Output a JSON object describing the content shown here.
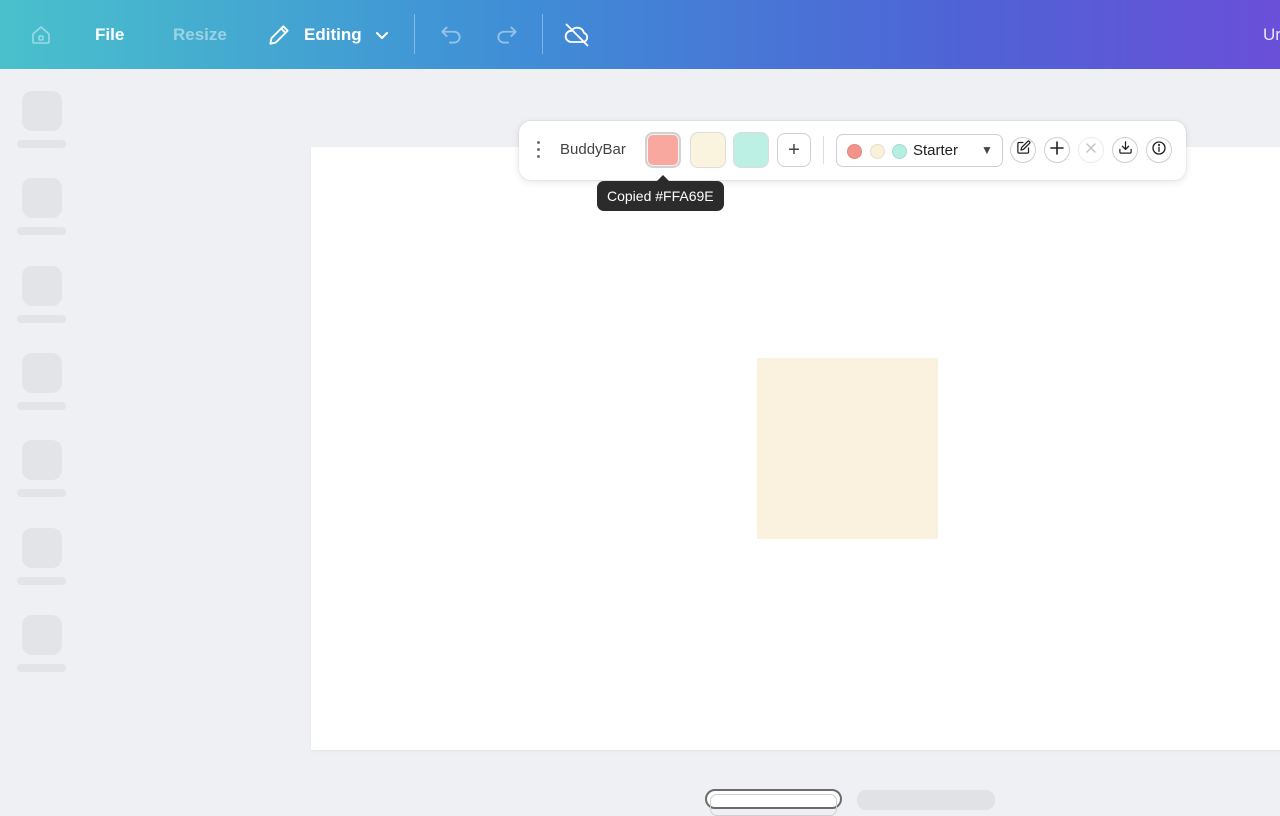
{
  "topbar": {
    "home_icon": "home-icon",
    "file_label": "File",
    "resize_label": "Resize",
    "mode_label": "Editing",
    "mode_icon": "pencil-icon",
    "undo_icon": "undo-icon",
    "redo_icon": "redo-icon",
    "sync_icon": "cloud-off-icon",
    "doc_title_partial": "Ur",
    "gradient_colors": [
      "#49c1cc",
      "#3f8ed6",
      "#4f63d6",
      "#6a4fd8"
    ]
  },
  "sidebar": {
    "item_count": 7,
    "state": "loading-skeleton"
  },
  "buddybar": {
    "title": "BuddyBar",
    "swatches": [
      {
        "color": "#FFA69E",
        "selected": true
      },
      {
        "color": "#FAF3DD",
        "selected": false
      },
      {
        "color": "#B8F2E6",
        "selected": false
      }
    ],
    "add_swatch_label": "+",
    "palette": {
      "name": "Starter",
      "dots": [
        "#F2938A",
        "#FAF1D9",
        "#B5EEE2"
      ]
    },
    "actions": [
      "edit-icon",
      "plus-icon",
      "close-icon",
      "download-icon",
      "info-icon"
    ]
  },
  "tooltip": {
    "text": "Copied #FFA69E"
  },
  "canvas": {
    "shape_color": "#FAF2DF"
  }
}
